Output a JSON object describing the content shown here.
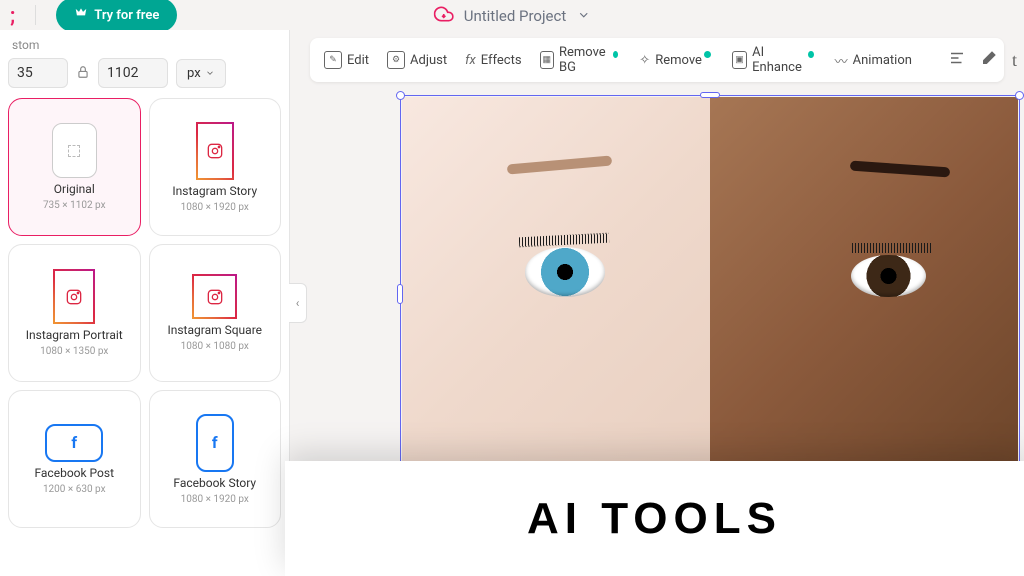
{
  "header": {
    "try_label": "Try for free",
    "project_title": "Untitled Project"
  },
  "sidebar": {
    "custom_label": "stom",
    "width": "35",
    "height": "1102",
    "unit": "px",
    "presets": [
      {
        "label": "Original",
        "dims": "735 × 1102 px"
      },
      {
        "label": "Instagram Story",
        "dims": "1080 × 1920 px"
      },
      {
        "label": "Instagram Portrait",
        "dims": "1080 × 1350 px"
      },
      {
        "label": "Instagram Square",
        "dims": "1080 × 1080 px"
      },
      {
        "label": "Facebook Post",
        "dims": "1200 × 630 px"
      },
      {
        "label": "Facebook Story",
        "dims": "1080 × 1920 px"
      }
    ]
  },
  "toolbar": {
    "edit": "Edit",
    "adjust": "Adjust",
    "effects": "Effects",
    "remove_bg": "Remove BG",
    "remove": "Remove",
    "ai_enhance": "AI Enhance",
    "animation": "Animation"
  },
  "overlay": {
    "title": "AI TOOLS"
  }
}
